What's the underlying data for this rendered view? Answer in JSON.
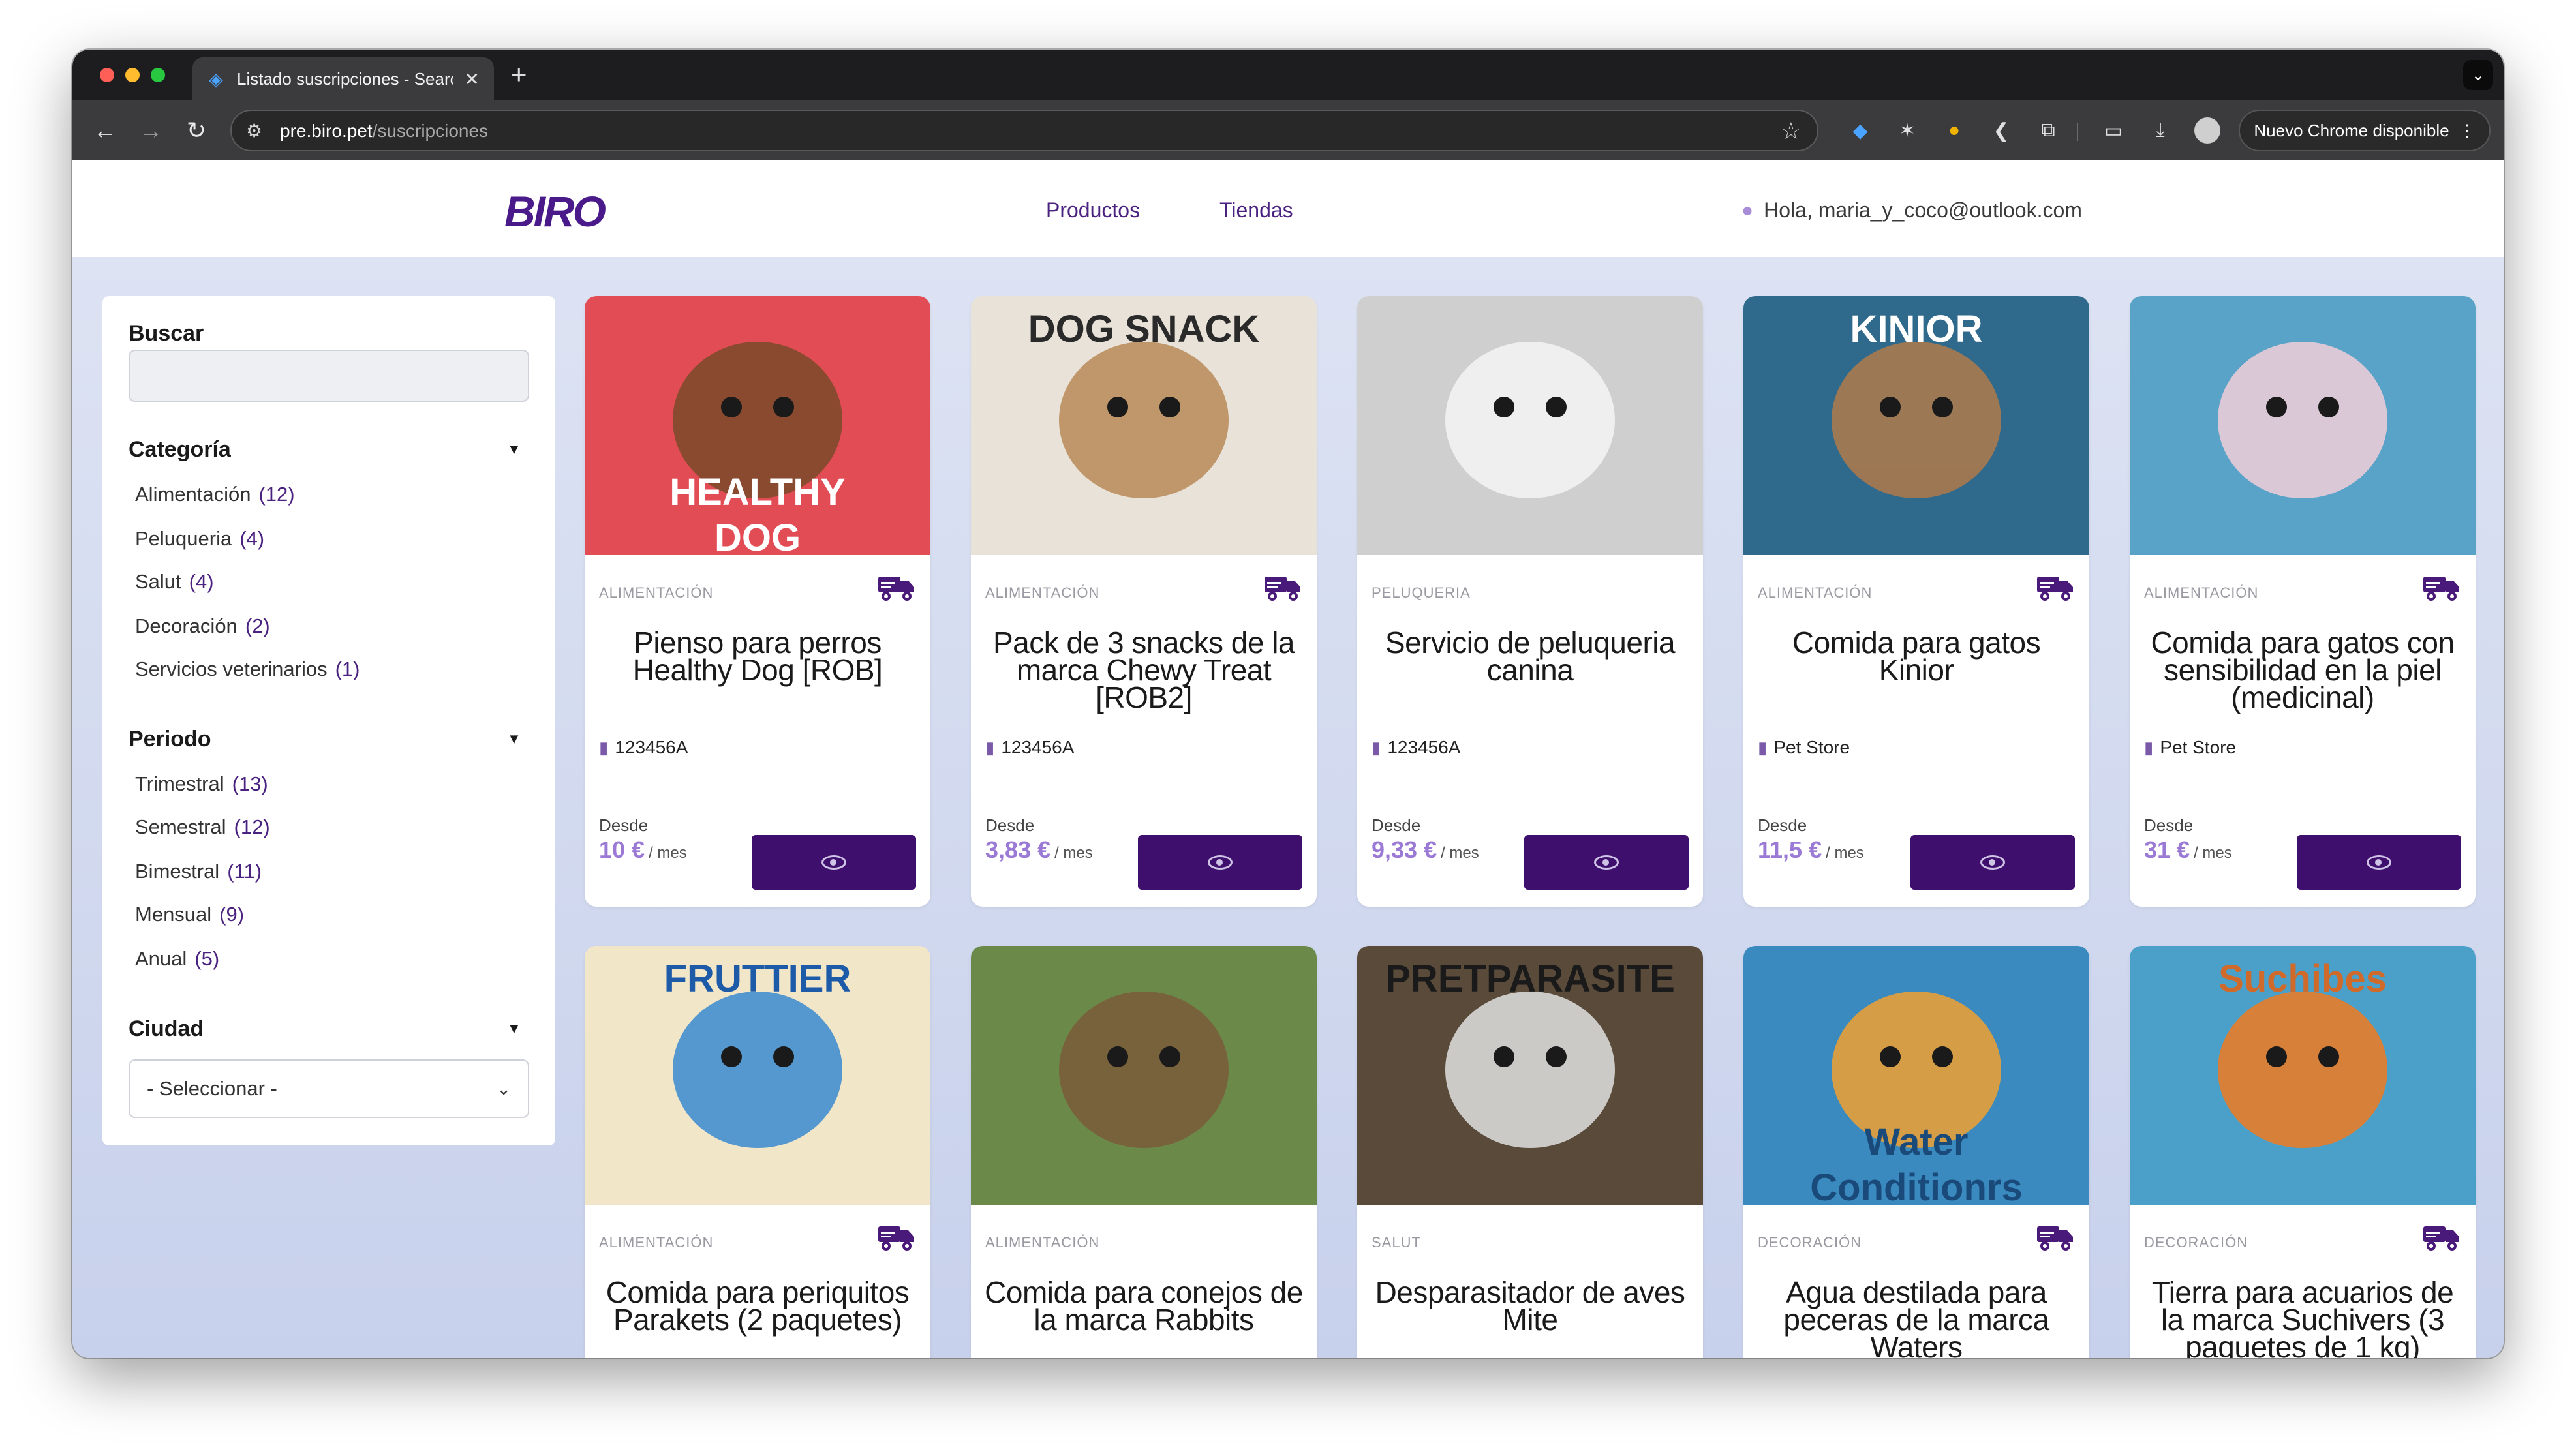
{
  "browser": {
    "tab_title": "Listado suscripciones - Searc",
    "tab_close": "✕",
    "new_tab": "+",
    "url_host": "pre.biro.pet",
    "url_path": "/suscripciones",
    "update_label": "Nuevo Chrome disponible",
    "update_menu": "⋮",
    "tab_menu": "⌄",
    "icons": [
      "back-icon",
      "forward-icon",
      "reload-icon",
      "site-settings-icon",
      "bookmark-star-icon",
      "extension-icon",
      "cast-icon",
      "download-icon",
      "profile-icon"
    ]
  },
  "site": {
    "logo": "BIRO",
    "nav": {
      "productos": "Productos",
      "tiendas": "Tiendas"
    },
    "greeting": "Hola, maria_y_coco@outlook.com"
  },
  "sidebar": {
    "search_label": "Buscar",
    "search_value": "",
    "categoria": {
      "title": "Categoría",
      "items": [
        {
          "label": "Alimentación",
          "count": "(12)"
        },
        {
          "label": "Peluqueria",
          "count": "(4)"
        },
        {
          "label": "Salut",
          "count": "(4)"
        },
        {
          "label": "Decoración",
          "count": "(2)"
        },
        {
          "label": "Servicios veterinarios",
          "count": "(1)"
        }
      ]
    },
    "periodo": {
      "title": "Periodo",
      "items": [
        {
          "label": "Trimestral",
          "count": "(13)"
        },
        {
          "label": "Semestral",
          "count": "(12)"
        },
        {
          "label": "Bimestral",
          "count": "(11)"
        },
        {
          "label": "Mensual",
          "count": "(9)"
        },
        {
          "label": "Anual",
          "count": "(5)"
        }
      ]
    },
    "ciudad": {
      "title": "Ciudad",
      "selected": "- Seleccionar -"
    }
  },
  "cards": [
    {
      "category": "ALIMENTACIÓN",
      "name": "Pienso para perros Healthy Dog [ROB]",
      "store": "123456A",
      "desde": "Desde",
      "price": "10 €",
      "unit": "/ mes",
      "delivery": true
    },
    {
      "category": "ALIMENTACIÓN",
      "name": "Pack de 3 snacks de la marca Chewy Treat [ROB2]",
      "store": "123456A",
      "desde": "Desde",
      "price": "3,83 €",
      "unit": "/ mes",
      "delivery": true
    },
    {
      "category": "PELUQUERIA",
      "name": "Servicio de peluqueria canina",
      "store": "123456A",
      "desde": "Desde",
      "price": "9,33 €",
      "unit": "/ mes",
      "delivery": false
    },
    {
      "category": "ALIMENTACIÓN",
      "name": "Comida para gatos Kinior",
      "store": "Pet Store",
      "desde": "Desde",
      "price": "11,5 €",
      "unit": "/ mes",
      "delivery": true
    },
    {
      "category": "ALIMENTACIÓN",
      "name": "Comida para gatos con sensibilidad en la piel (medicinal)",
      "store": "Pet Store",
      "desde": "Desde",
      "price": "31 €",
      "unit": "/ mes",
      "delivery": true
    },
    {
      "category": "ALIMENTACIÓN",
      "name": "Comida para periquitos Parakets (2 paquetes)",
      "delivery": true
    },
    {
      "category": "ALIMENTACIÓN",
      "name": "Comida para conejos de la marca Rabbits",
      "delivery": false
    },
    {
      "category": "SALUT",
      "name": "Desparasitador de aves Mite",
      "delivery": false
    },
    {
      "category": "DECORACIÓN",
      "name": "Agua destilada para peceras de la marca Waters",
      "delivery": true
    },
    {
      "category": "DECORACIÓN",
      "name": "Tierra para acuarios de la marca Suchivers (3 paquetes de 1 kg)",
      "delivery": true
    }
  ],
  "card_images": [
    {
      "text_lines": [
        "HEALTHY",
        "DOG"
      ],
      "text_color": "#ffffff",
      "bg": "#e24d55",
      "accent": "#7a4a2a"
    },
    {
      "text_lines": [
        "DOG SNACK"
      ],
      "text_color": "#2a2a2a",
      "bg": "#e8e2d8",
      "accent": "#b88a58"
    },
    {
      "text_lines": [],
      "text_color": "#000000",
      "bg": "#cfcfcf",
      "accent": "#f4f4f4"
    },
    {
      "text_lines": [
        "KINIOR"
      ],
      "text_color": "#ffffff",
      "bg": "#2f6a8c",
      "accent": "#b07a4a"
    },
    {
      "text_lines": [],
      "text_color": "#ffffff",
      "bg": "#5aa3c8",
      "accent": "#f2cfd8"
    },
    {
      "text_lines": [
        "FRUTTIER"
      ],
      "text_color": "#1d5aa8",
      "bg": "#f2e6c8",
      "accent": "#3a8ad0"
    },
    {
      "text_lines": [],
      "text_color": "#000000",
      "bg": "#6b8a4a",
      "accent": "#7a5a3a"
    },
    {
      "text_lines": [
        "PRETPARASITE"
      ],
      "text_color": "#1a1a1a",
      "bg": "#5a4a3a",
      "accent": "#e0e0e0"
    },
    {
      "text_lines": [
        "Water",
        "Conditionrs"
      ],
      "text_color": "#1a4a7a",
      "bg": "#3a8ac0",
      "accent": "#f0a030"
    },
    {
      "text_lines": [
        "Suchibes"
      ],
      "text_color": "#d06a2a",
      "bg": "#4aa0c8",
      "accent": "#f07a20"
    }
  ],
  "colors": {
    "brand": "#3f0f6e",
    "price": "#9b7ad6",
    "link": "#4a2280",
    "page_bg": "#dde3f3"
  }
}
